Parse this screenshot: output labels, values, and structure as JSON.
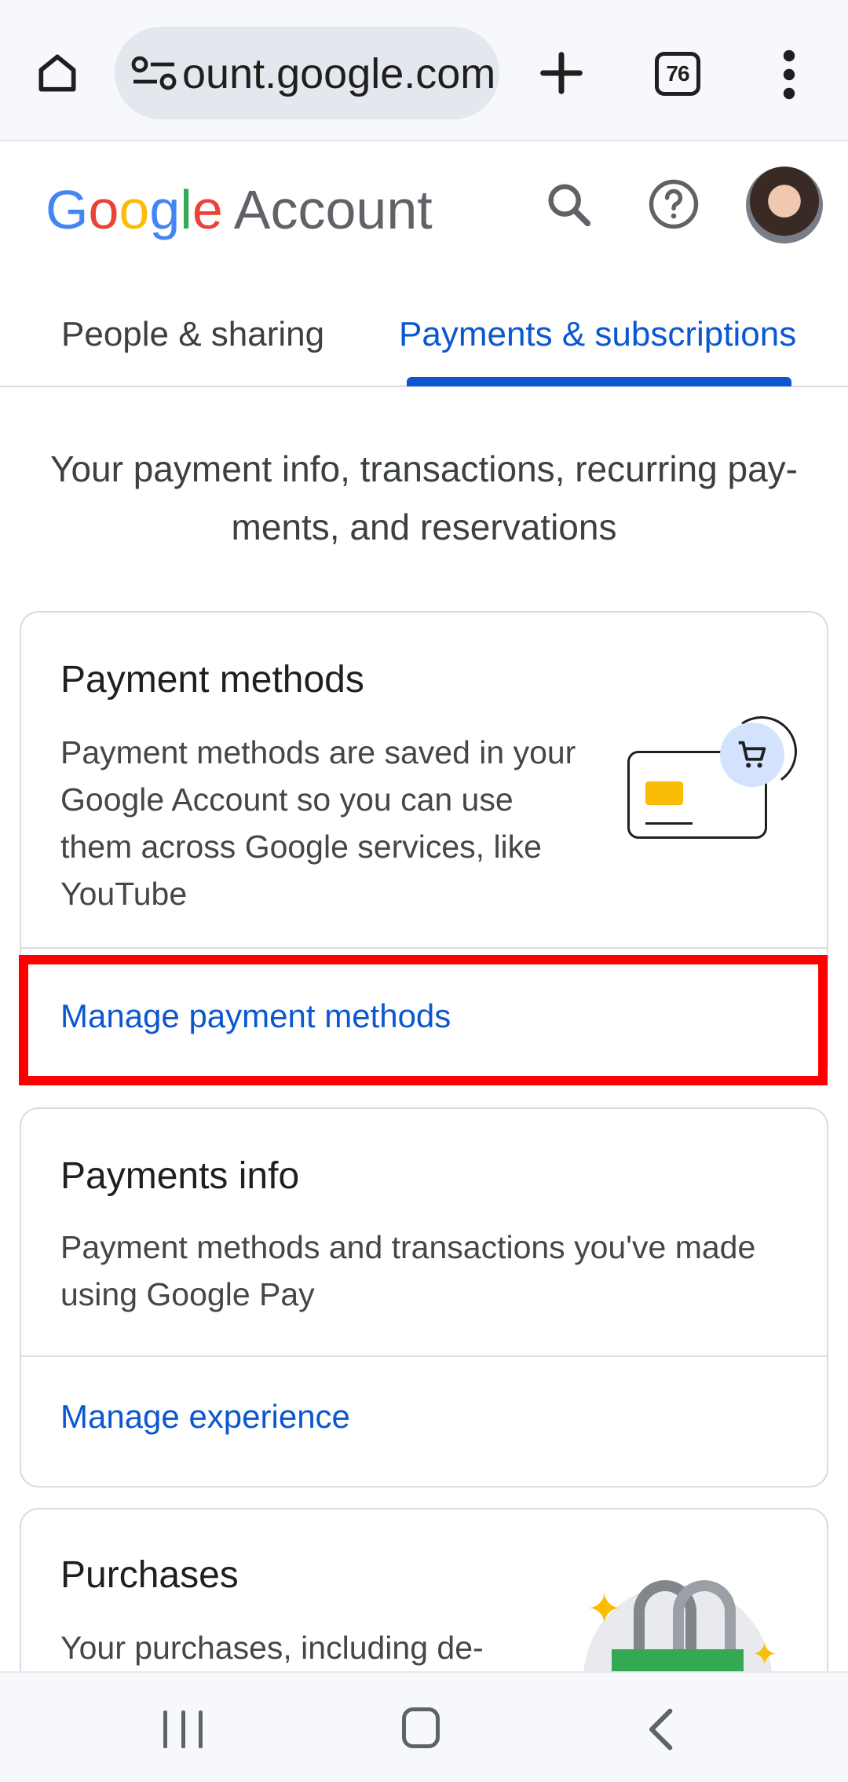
{
  "browser": {
    "url": "ount.google.com",
    "tab_count": "76"
  },
  "header": {
    "logo_letters": [
      "G",
      "o",
      "o",
      "g",
      "l",
      "e"
    ],
    "logo_suffix": "Account"
  },
  "nav_tabs": [
    {
      "label": "People & sharing",
      "selected": false
    },
    {
      "label": "Payments & subscriptions",
      "selected": true
    }
  ],
  "intro_text": "Your payment info, transactions, recurring pay-ments, and reservations",
  "cards": {
    "payment_methods": {
      "title": "Payment methods",
      "description": "Payment methods are saved in your Google Account so you can use them across Google services, like YouTube",
      "link": "Manage payment methods"
    },
    "payments_info": {
      "title": "Payments info",
      "description": "Payment methods and transactions you've made using Google Pay",
      "link": "Manage experience"
    },
    "purchases": {
      "title": "Purchases",
      "description": "Your purchases, including de-"
    }
  },
  "colors": {
    "accent_blue": "#0b57d0",
    "highlight_red": "#ff0000",
    "google_blue": "#4285f4",
    "google_red": "#ea4335",
    "google_yellow": "#fbbc05",
    "google_green": "#34a853"
  },
  "icons": [
    "home-icon",
    "tune-icon",
    "plus-icon",
    "tab-switcher-icon",
    "more-vert-icon",
    "search-icon",
    "help-icon",
    "cart-icon",
    "recents-icon",
    "home-nav-icon",
    "back-icon"
  ]
}
